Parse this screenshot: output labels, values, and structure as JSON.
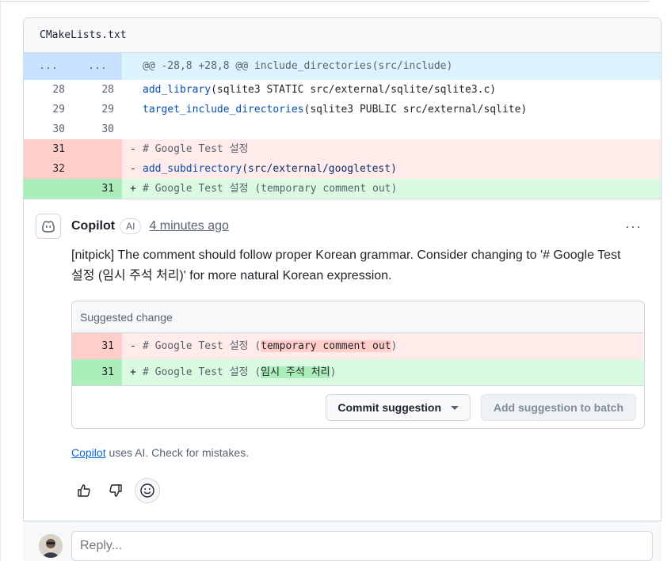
{
  "file": {
    "name": "CMakeLists.txt"
  },
  "hunk": {
    "left": "...",
    "right": "...",
    "header": "@@ -28,8 +28,8 @@ include_directories(src/include)"
  },
  "lines": [
    {
      "type": "ctx",
      "old": "28",
      "new": "28",
      "sign": "",
      "fn": "add_library",
      "rest": "(sqlite3 STATIC src/external/sqlite/sqlite3.c)"
    },
    {
      "type": "ctx",
      "old": "29",
      "new": "29",
      "sign": "",
      "fn": "target_include_directories",
      "rest": "(sqlite3 PUBLIC src/external/sqlite)"
    },
    {
      "type": "ctx",
      "old": "30",
      "new": "30",
      "sign": "",
      "fn": "",
      "rest": ""
    },
    {
      "type": "del",
      "old": "31",
      "new": "",
      "sign": "-",
      "fn": "",
      "rest": "# Google Test 설정"
    },
    {
      "type": "del",
      "old": "32",
      "new": "",
      "sign": "-",
      "fn": "add_subdirectory",
      "rest": "(src/external/googletest)"
    },
    {
      "type": "add",
      "old": "",
      "new": "31",
      "sign": "+",
      "fn": "",
      "rest": "# Google Test 설정 (temporary comment out)"
    }
  ],
  "comment": {
    "author": "Copilot",
    "badge": "AI",
    "time": "4 minutes ago",
    "more": "···",
    "body": "[nitpick] The comment should follow proper Korean grammar. Consider changing to '# Google Test 설정 (임시 주석 처리)' for more natural Korean expression."
  },
  "suggestion": {
    "title": "Suggested change",
    "del": {
      "num": "31",
      "sign": "-",
      "prefix": "# Google Test 설정 (",
      "highlight": "temporary comment out",
      "suffix": ")"
    },
    "add": {
      "num": "31",
      "sign": "+",
      "prefix": "# Google Test 설정 (",
      "highlight": "임시 주석 처리",
      "suffix": ")"
    },
    "commit_label": "Commit suggestion",
    "batch_label": "Add suggestion to batch"
  },
  "disclaimer": {
    "link": "Copilot",
    "text": " uses AI. Check for mistakes."
  },
  "reactions": [
    "thumbs-up-icon",
    "thumbs-down-icon",
    "smiley-icon"
  ],
  "reply": {
    "placeholder": "Reply..."
  },
  "colors": {
    "del_line": "#ffebe9",
    "add_line": "#dafbe1",
    "hunk": "#ddf4ff",
    "link": "#0969da"
  }
}
